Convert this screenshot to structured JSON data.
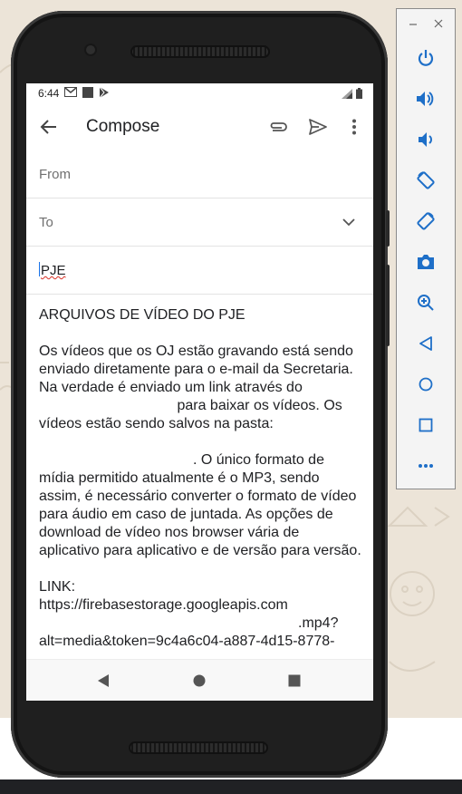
{
  "status_bar": {
    "time": "6:44"
  },
  "app_bar": {
    "title": "Compose"
  },
  "fields": {
    "from_label": "From",
    "to_label": "To",
    "subject_value": "PJE"
  },
  "body": {
    "heading": "ARQUIVOS DE VÍDEO DO PJE",
    "p1_a": "Os vídeos que os OJ estão gravando está sendo enviado diretamente para o e-mail da Secretaria. Na verdade é enviado um link através do ",
    "p1_b": " para baixar os vídeos. Os vídeos estão sendo salvos na pasta:",
    "p2": ". O único formato de mídia permitido atualmente é o MP3, sendo assim, é necessário converter o formato de vídeo para áudio em caso de juntada. As opções de download de vídeo nos browser vária de aplicativo para aplicativo e de versão para versão.",
    "link_label": "LINK:",
    "link_line1": "https://firebasestorage.googleapis.com",
    "link_line2": ".mp4?",
    "link_line3": "alt=media&token=9c4a6c04-a887-4d15-8778-"
  },
  "colors": {
    "wallpaper": "#ece4d8",
    "phone_body": "#1f1f1f",
    "screen": "#ffffff",
    "text_primary": "#202124",
    "text_secondary": "#6f6f6f",
    "spellcheck_underline": "#d93025",
    "emulator_icons": "#1e6fc8"
  },
  "icons": {
    "status": [
      "gmail-notification-icon",
      "square-notification-icon",
      "play-store-notification-icon",
      "signal-icon",
      "battery-icon"
    ],
    "app_bar": [
      "back-arrow-icon",
      "attach-icon",
      "send-icon",
      "more-vert-icon"
    ],
    "nav_bar": [
      "nav-back-icon",
      "nav-home-icon",
      "nav-recents-icon"
    ],
    "emulator_toolbar": [
      "power-icon",
      "volume-up-icon",
      "volume-down-icon",
      "rotate-left-icon",
      "rotate-right-icon",
      "screenshot-icon",
      "zoom-icon",
      "back-icon",
      "home-icon",
      "overview-icon",
      "more-icon"
    ],
    "window_controls": [
      "minimize-icon",
      "close-icon"
    ]
  }
}
